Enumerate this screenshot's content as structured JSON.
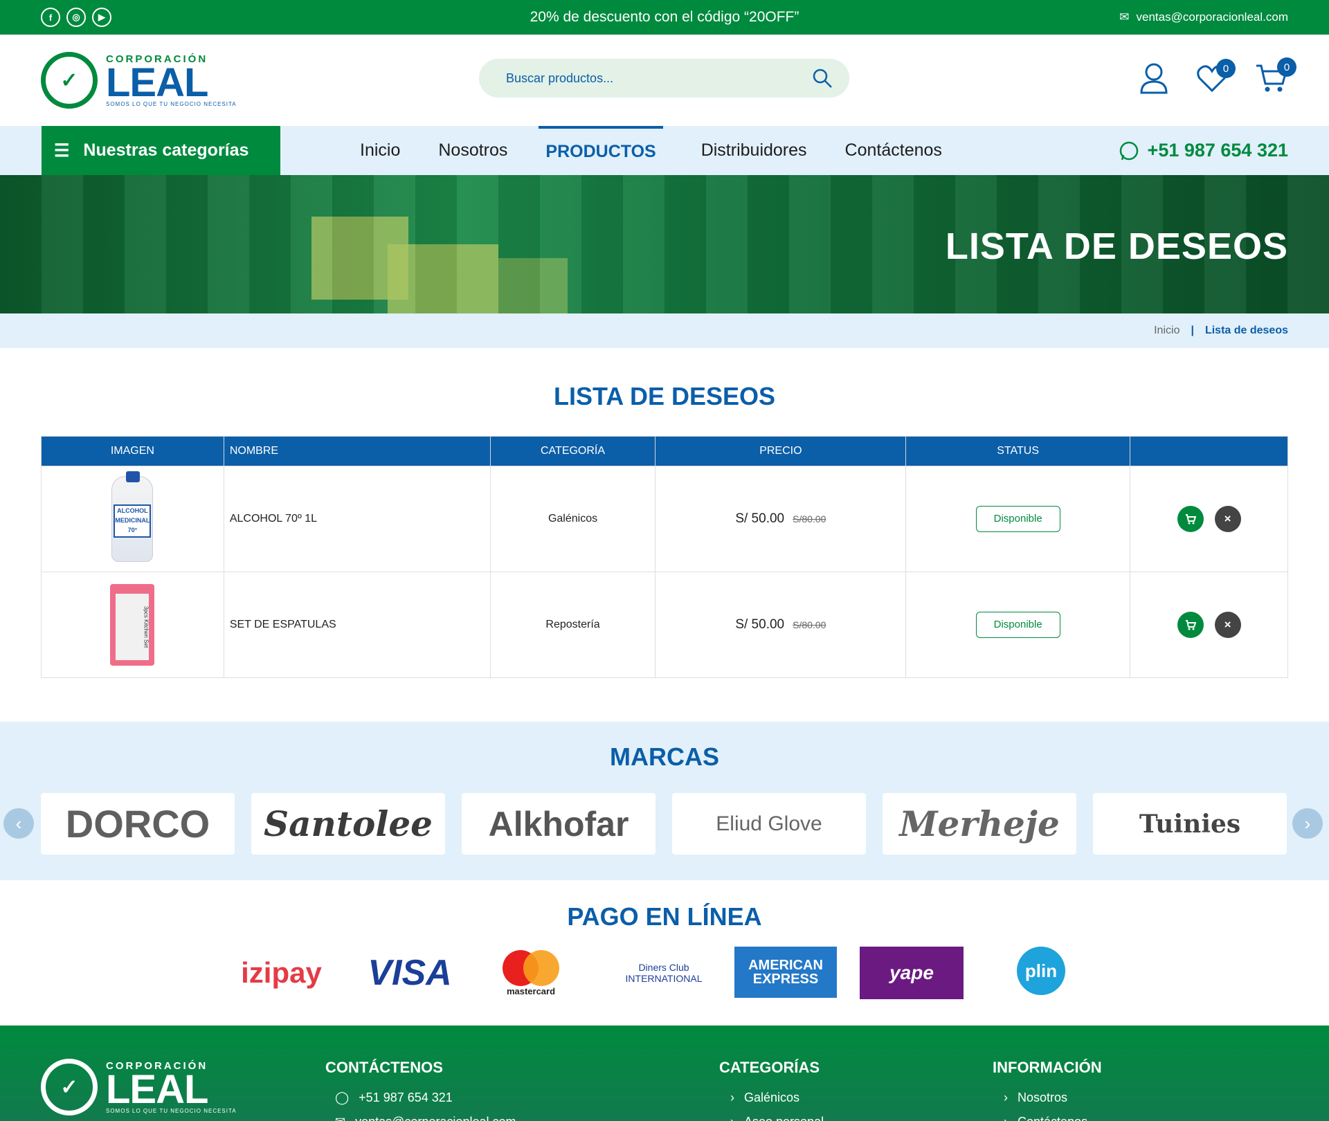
{
  "topbar": {
    "social": [
      "facebook-icon",
      "instagram-icon",
      "youtube-icon"
    ],
    "promo": "20% de descuento con el código “20OFF”",
    "email": "ventas@corporacionleal.com"
  },
  "header": {
    "logo_line1": "CORPORACIÓN",
    "logo_line2": "LEAL",
    "logo_tagline": "SOMOS LO QUE TU NEGOCIO NECESITA",
    "search_placeholder": "Buscar productos...",
    "wishlist_count": "0",
    "cart_count": "0"
  },
  "nav": {
    "categories_label": "Nuestras categorías",
    "items": [
      "Inicio",
      "Nosotros",
      "PRODUCTOS",
      "Distribuidores",
      "Contáctenos"
    ],
    "active_index": 2,
    "phone": "+51 987 654 321"
  },
  "hero": {
    "title": "LISTA DE DESEOS"
  },
  "breadcrumb": {
    "home": "Inicio",
    "separator": "|",
    "current": "Lista de deseos"
  },
  "wishlist": {
    "title": "LISTA DE DESEOS",
    "columns": [
      "IMAGEN",
      "NOMBRE",
      "CATEGORÍA",
      "PRECIO",
      "STATUS",
      ""
    ],
    "rows": [
      {
        "name": "ALCOHOL 70º 1L",
        "category": "Galénicos",
        "price": "S/ 50.00",
        "old_price": "S/80.00",
        "status": "Disponible",
        "image_label": "ALCOHOL MEDICINAL 70°"
      },
      {
        "name": "SET DE ESPATULAS",
        "category": "Repostería",
        "price": "S/ 50.00",
        "old_price": "S/80.00",
        "status": "Disponible",
        "image_label": "3pcs Kitchen Set"
      }
    ]
  },
  "marcas": {
    "title": "MARCAS",
    "brands": [
      "DORCO",
      "Santolee",
      "Alkhofar",
      "Eliud Glove",
      "Merheje",
      "Tuinies"
    ]
  },
  "pago": {
    "title": "PAGO EN LÍNEA",
    "methods": [
      "izipay",
      "VISA",
      "mastercard",
      "Diners Club INTERNATIONAL",
      "AMERICAN EXPRESS",
      "yape",
      "plin"
    ]
  },
  "footer": {
    "contact_title": "CONTÁCTENOS",
    "contact_phone": "+51 987 654 321",
    "contact_email": "ventas@corporacionleal.com",
    "categories_title": "CATEGORÍAS",
    "categories": [
      "Galénicos",
      "Aseo personal"
    ],
    "info_title": "INFORMACIÓN",
    "info": [
      "Nosotros",
      "Contáctenos"
    ]
  },
  "colors": {
    "green": "#008a3e",
    "blue": "#0b5ea8",
    "light_blue": "#e1f0fa"
  }
}
